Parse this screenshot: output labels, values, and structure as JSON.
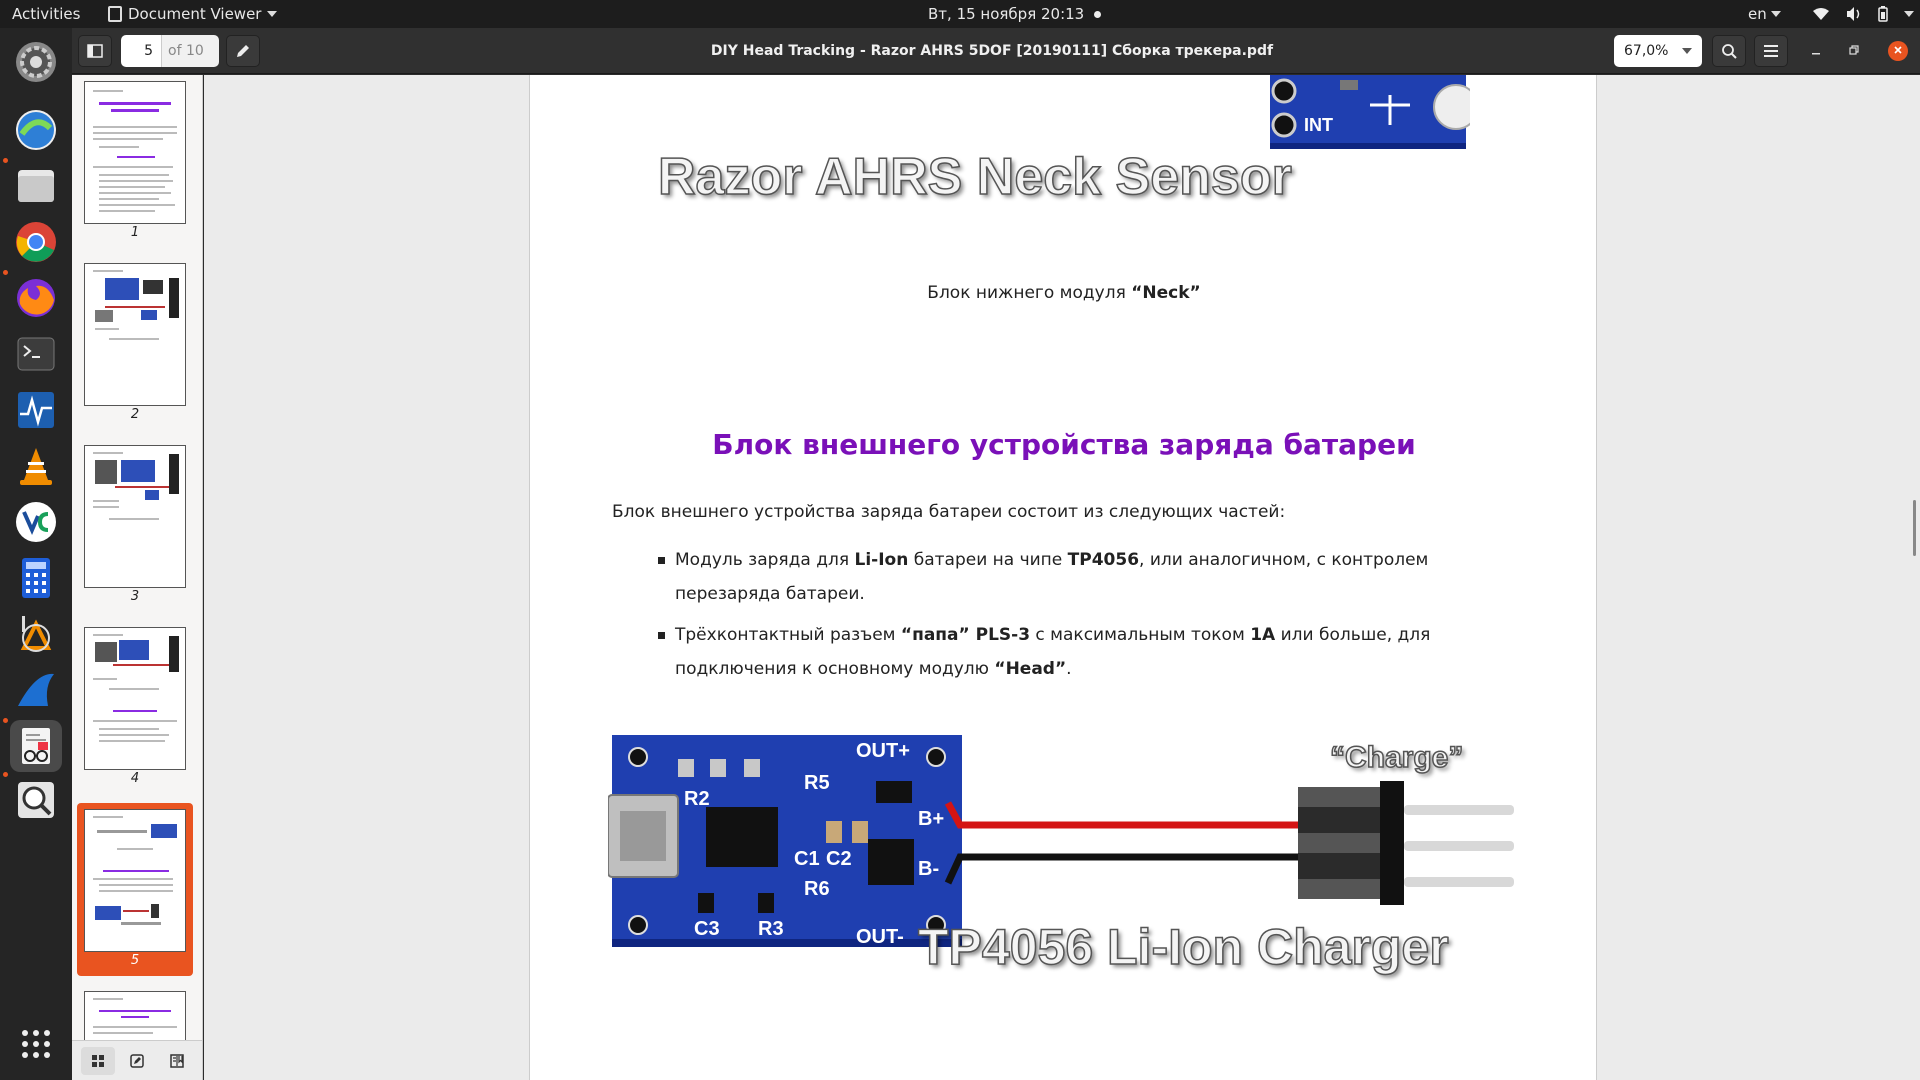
{
  "topbar": {
    "activities": "Activities",
    "app_menu": "Document Viewer",
    "clock": "Вт, 15 ноября  20:13",
    "language": "en"
  },
  "dock": {
    "apps": [
      {
        "name": "settings",
        "icon": "gear-icon"
      },
      {
        "name": "network",
        "icon": "network-globe-icon"
      },
      {
        "name": "files",
        "icon": "folder-icon"
      },
      {
        "name": "chrome",
        "icon": "chrome-icon"
      },
      {
        "name": "firefox",
        "icon": "firefox-icon"
      },
      {
        "name": "terminal",
        "icon": "terminal-icon"
      },
      {
        "name": "system-monitor",
        "icon": "monitor-icon"
      },
      {
        "name": "vlc",
        "icon": "vlc-cone-icon"
      },
      {
        "name": "veracrypt",
        "icon": "veracrypt-icon"
      },
      {
        "name": "calculator",
        "icon": "calculator-icon"
      },
      {
        "name": "inkscape",
        "icon": "inkscape-icon"
      },
      {
        "name": "wireshark",
        "icon": "shark-fin-icon"
      },
      {
        "name": "document-viewer",
        "icon": "document-viewer-icon"
      },
      {
        "name": "magnifier",
        "icon": "magnifier-icon"
      }
    ],
    "veracrypt_label": "VeraCrypt"
  },
  "header": {
    "current_page": "5",
    "total_pages": "of 10",
    "title": "DIY Head Tracking - Razor AHRS 5DOF [20190111] Сборка трекера.pdf",
    "zoom": "67,0%",
    "colors": {
      "accent": "#e95420"
    }
  },
  "sidebar": {
    "thumbnails": [
      {
        "label": "1"
      },
      {
        "label": "2"
      },
      {
        "label": "3"
      },
      {
        "label": "4"
      },
      {
        "label": "5",
        "selected": true
      },
      {
        "label": ""
      }
    ]
  },
  "document": {
    "neck_banner": "Razor AHRS Neck Sensor",
    "neck_board_int": "INT",
    "neck_caption_prefix": "Блок нижнего модуля ",
    "neck_caption_bold": "“Neck”",
    "section_heading": "Блок внешнего устройства заряда батареи",
    "intro": "Блок внешнего устройства заряда батареи состоит из следующих частей:",
    "bullet1": {
      "t1": "Модуль заряда для ",
      "b1": "Li-Ion",
      "t2": " батареи на чипе ",
      "b2": "TP4056",
      "t3": ", или аналогичном, с контролем перезаряда батареи."
    },
    "bullet2": {
      "t1": "Трёхконтактный разъем ",
      "b1": "“папа” PLS-3",
      "t2": " с максимальным током ",
      "b2": "1А",
      "t3": " или больше, для подключения к основному модулю ",
      "b3": "“Head”",
      "t4": "."
    },
    "charger_banner": "TP4056 Li-Ion Charger",
    "charge_label": "“Charge”",
    "pcb_labels": {
      "out_plus": "OUT+",
      "out_minus": "OUT-",
      "b_plus": "B+",
      "b_minus": "B-",
      "r2": "R2",
      "r3": "R3",
      "r5": "R5",
      "r6": "R6",
      "c1": "C1",
      "c2": "C2",
      "c3": "C3"
    },
    "colors": {
      "heading": "#7a10b8",
      "pcb": "#1f3fb0",
      "wire_red": "#d41414"
    }
  }
}
